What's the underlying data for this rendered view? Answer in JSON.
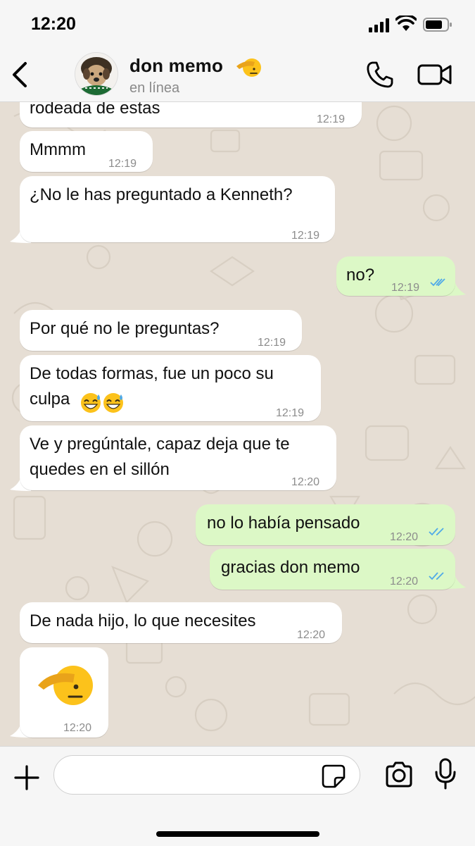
{
  "status_bar": {
    "time": "12:20"
  },
  "header": {
    "contact_name": "don memo",
    "contact_status": "en línea",
    "name_emoji_icon": "saluting-face-icon"
  },
  "messages": [
    {
      "dir": "in",
      "text": "rodeada de estas",
      "time": "12:19"
    },
    {
      "dir": "in",
      "text": "Mmmm",
      "time": "12:19"
    },
    {
      "dir": "in",
      "text": "¿No le has preguntado a Kenneth?",
      "time": "12:19"
    },
    {
      "dir": "out",
      "text": "no?",
      "time": "12:19",
      "status": "read"
    },
    {
      "dir": "in",
      "text": "Por qué no le preguntas?",
      "time": "12:19"
    },
    {
      "dir": "in",
      "text_line1": "De todas formas, fue un poco su",
      "text_line2": "culpa",
      "emoji": "grinning-sweat-face-icon",
      "time": "12:19"
    },
    {
      "dir": "in",
      "text_line1": "Ve y pregúntale, capaz deja que te",
      "text_line2": "quedes en el sillón",
      "time": "12:20"
    },
    {
      "dir": "out",
      "text": "no lo había pensado",
      "time": "12:20",
      "status": "read"
    },
    {
      "dir": "out",
      "text": "gracias don memo",
      "time": "12:20",
      "status": "read"
    },
    {
      "dir": "in",
      "text": "De nada hijo, lo que necesites",
      "time": "12:20"
    },
    {
      "dir": "in",
      "emoji": "saluting-face-icon",
      "time": "12:20"
    }
  ],
  "input": {
    "placeholder": ""
  },
  "colors": {
    "incoming_bubble": "#ffffff",
    "outgoing_bubble": "#dcf8c6",
    "read_ticks": "#4fa9e8",
    "wallpaper": "#e6ded4",
    "bar": "#f6f6f6"
  }
}
